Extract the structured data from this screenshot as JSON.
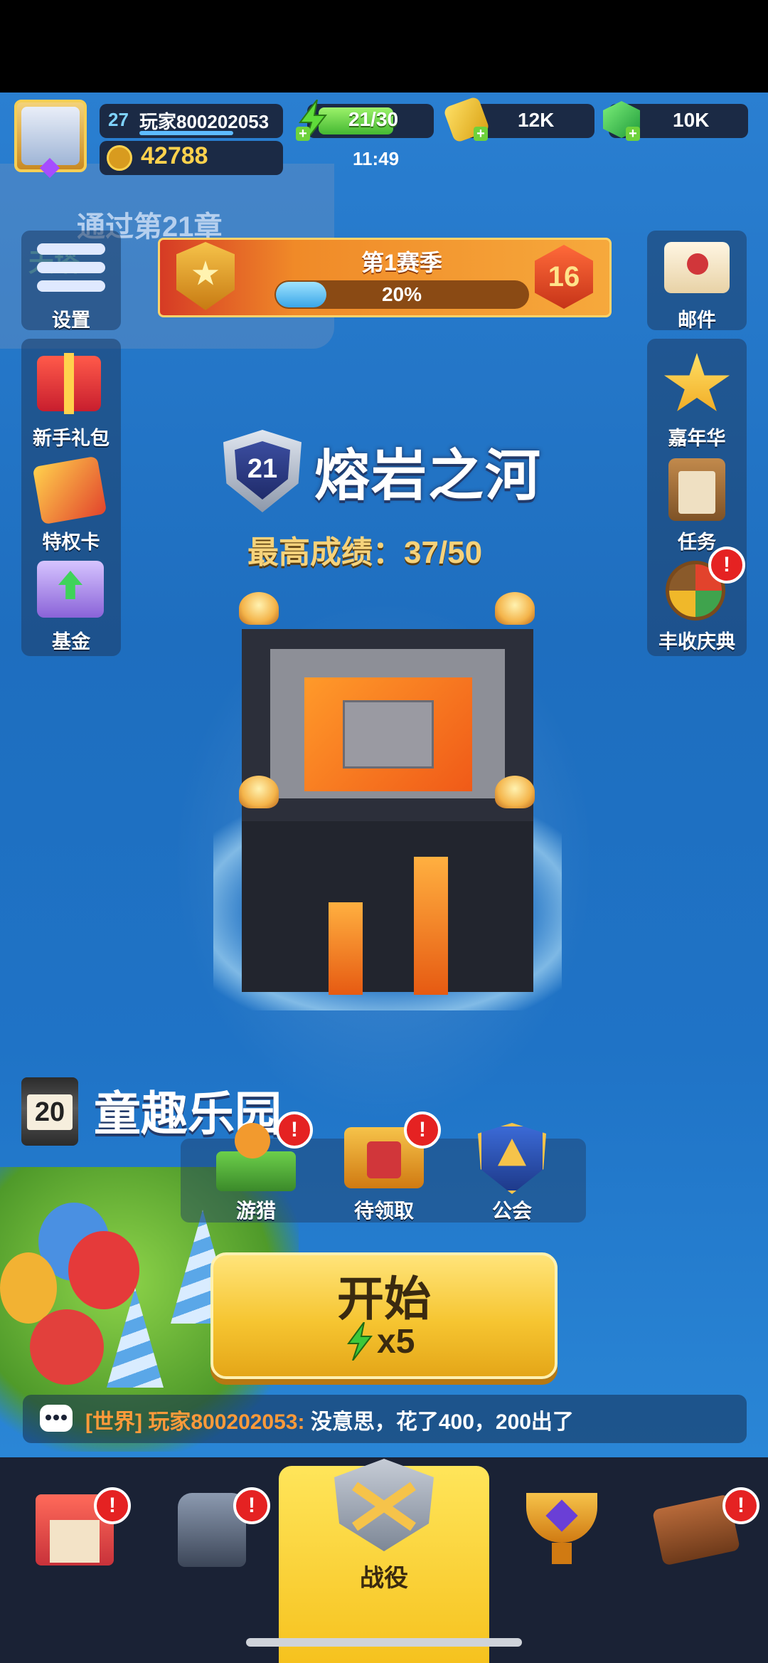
{
  "player": {
    "level": "27",
    "name": "玩家800202053",
    "gold": "42788",
    "xp_progress": 0.6
  },
  "resources": {
    "energy": "21/30",
    "energy_progress": 0.7,
    "refill_timer": "11:49",
    "tickets": "12K",
    "gems": "10K"
  },
  "background": {
    "prev_chapter_text": "通过第21章",
    "prev_tower_text": "天塔"
  },
  "left_menu": [
    {
      "label": "设置",
      "icon": "menu-lines-icon"
    },
    {
      "label": "新手礼包",
      "icon": "gift-box-icon"
    },
    {
      "label": "特权卡",
      "icon": "privilege-card-icon"
    },
    {
      "label": "基金",
      "icon": "fund-chest-icon"
    }
  ],
  "right_menu": [
    {
      "label": "邮件",
      "icon": "mail-envelope-icon",
      "alert": false
    },
    {
      "label": "嘉年华",
      "icon": "carnival-star-icon",
      "alert": false
    },
    {
      "label": "任务",
      "icon": "task-clipboard-icon",
      "alert": false
    },
    {
      "label": "丰收庆典",
      "icon": "harvest-wheel-icon",
      "alert": true
    }
  ],
  "season": {
    "title": "第1赛季",
    "progress_text": "20%",
    "progress": 0.2,
    "level": "16"
  },
  "stage": {
    "number": "21",
    "name": "熔岩之河",
    "best_score": "最高成绩：37/50"
  },
  "chapter": {
    "number": "20",
    "name": "童趣乐园"
  },
  "actions": [
    {
      "label": "游猎",
      "icon": "safari-island-icon",
      "alert": true
    },
    {
      "label": "待领取",
      "icon": "treasure-chest-icon",
      "alert": true
    },
    {
      "label": "公会",
      "icon": "guild-shield-icon",
      "alert": false
    }
  ],
  "start_button": {
    "label": "开始",
    "cost": "x5"
  },
  "chat": {
    "channel": "[世界]",
    "sender": "玩家800202053:",
    "message": "没意思，花了400，200出了"
  },
  "bottom_nav": {
    "active_label": "战役",
    "items": [
      {
        "icon": "shop-icon",
        "alert": true
      },
      {
        "icon": "armor-icon",
        "alert": true
      },
      {
        "icon": "crossed-swords-icon",
        "label": "战役",
        "alert": false
      },
      {
        "icon": "trophy-icon",
        "alert": false
      },
      {
        "icon": "workshop-icon",
        "alert": true
      }
    ]
  },
  "colors": {
    "accent_yellow": "#f6c531",
    "alert_red": "#e52222",
    "sea_blue": "#1f6fc0",
    "energy_green": "#44b832",
    "gold_text": "#ffd24d"
  }
}
